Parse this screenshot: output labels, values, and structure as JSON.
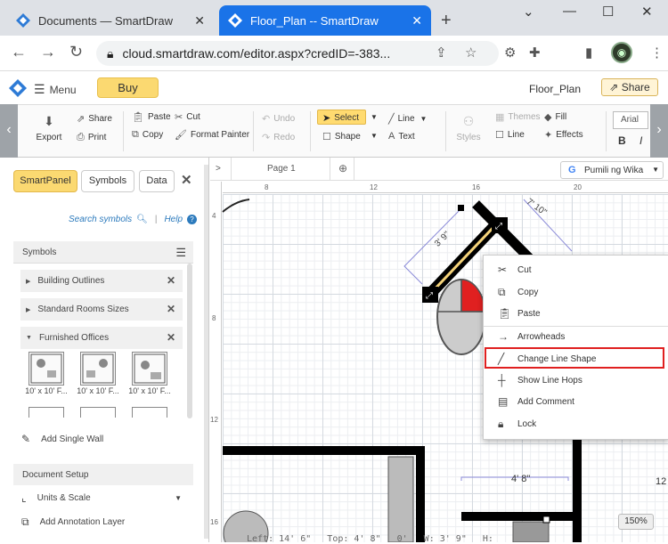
{
  "browser": {
    "tabs": [
      {
        "title": "Documents — SmartDraw"
      },
      {
        "title": "Floor_Plan -- SmartDraw"
      }
    ],
    "new_tab": "+",
    "url": "cloud.smartdraw.com/editor.aspx?credID=-383..."
  },
  "app": {
    "menu_label": "Menu",
    "buy_label": "Buy",
    "doc_title": "Floor_Plan",
    "share_label": "Share"
  },
  "ribbon": {
    "export": "Export",
    "share": "Share",
    "print": "Print",
    "paste": "Paste",
    "copy": "Copy",
    "cut": "Cut",
    "format_painter": "Format Painter",
    "undo": "Undo",
    "redo": "Redo",
    "select": "Select",
    "shape": "Shape",
    "line": "Line",
    "text": "Text",
    "styles": "Styles",
    "themes": "Themes",
    "line2": "Line",
    "fill": "Fill",
    "effects": "Effects",
    "font": "Arial",
    "bold": "B",
    "italic": "I"
  },
  "panel": {
    "tabs": [
      "SmartPanel",
      "Symbols",
      "Data"
    ],
    "search": "Search symbols",
    "help": "Help",
    "symbols_header": "Symbols",
    "libraries": [
      "Building Outlines",
      "Standard Rooms Sizes",
      "Furnished Offices"
    ],
    "thumb_labels": [
      "10' x 10' F...",
      "10' x 10' F...",
      "10' x 10' F..."
    ],
    "add_single_wall": "Add Single Wall",
    "doc_setup": "Document Setup",
    "units_scale": "Units & Scale",
    "add_annotation": "Add Annotation Layer"
  },
  "canvas": {
    "page_label": "Page 1",
    "pumil": "Pumili ng Wika",
    "ruler_h": [
      "8",
      "12",
      "16",
      "20"
    ],
    "ruler_v": [
      "4",
      "8",
      "12",
      "16"
    ],
    "dim1": "3' 9\"",
    "dim2": "7' 10\"",
    "dim3": "4' 8\"",
    "right_num": "12",
    "readout": "Left: 14' 6\"   Top: 4' 8\"   0'   W: 3' 9\"   H:",
    "zoom": "150%"
  },
  "context_menu": {
    "items": [
      "Cut",
      "Copy",
      "Paste",
      "Arrowheads",
      "Change Line Shape",
      "Show Line Hops",
      "Add Comment",
      "Lock"
    ],
    "highlight_color": "#e02020"
  },
  "colors": {
    "accent": "#1a73e8",
    "buy": "#fbd971"
  }
}
